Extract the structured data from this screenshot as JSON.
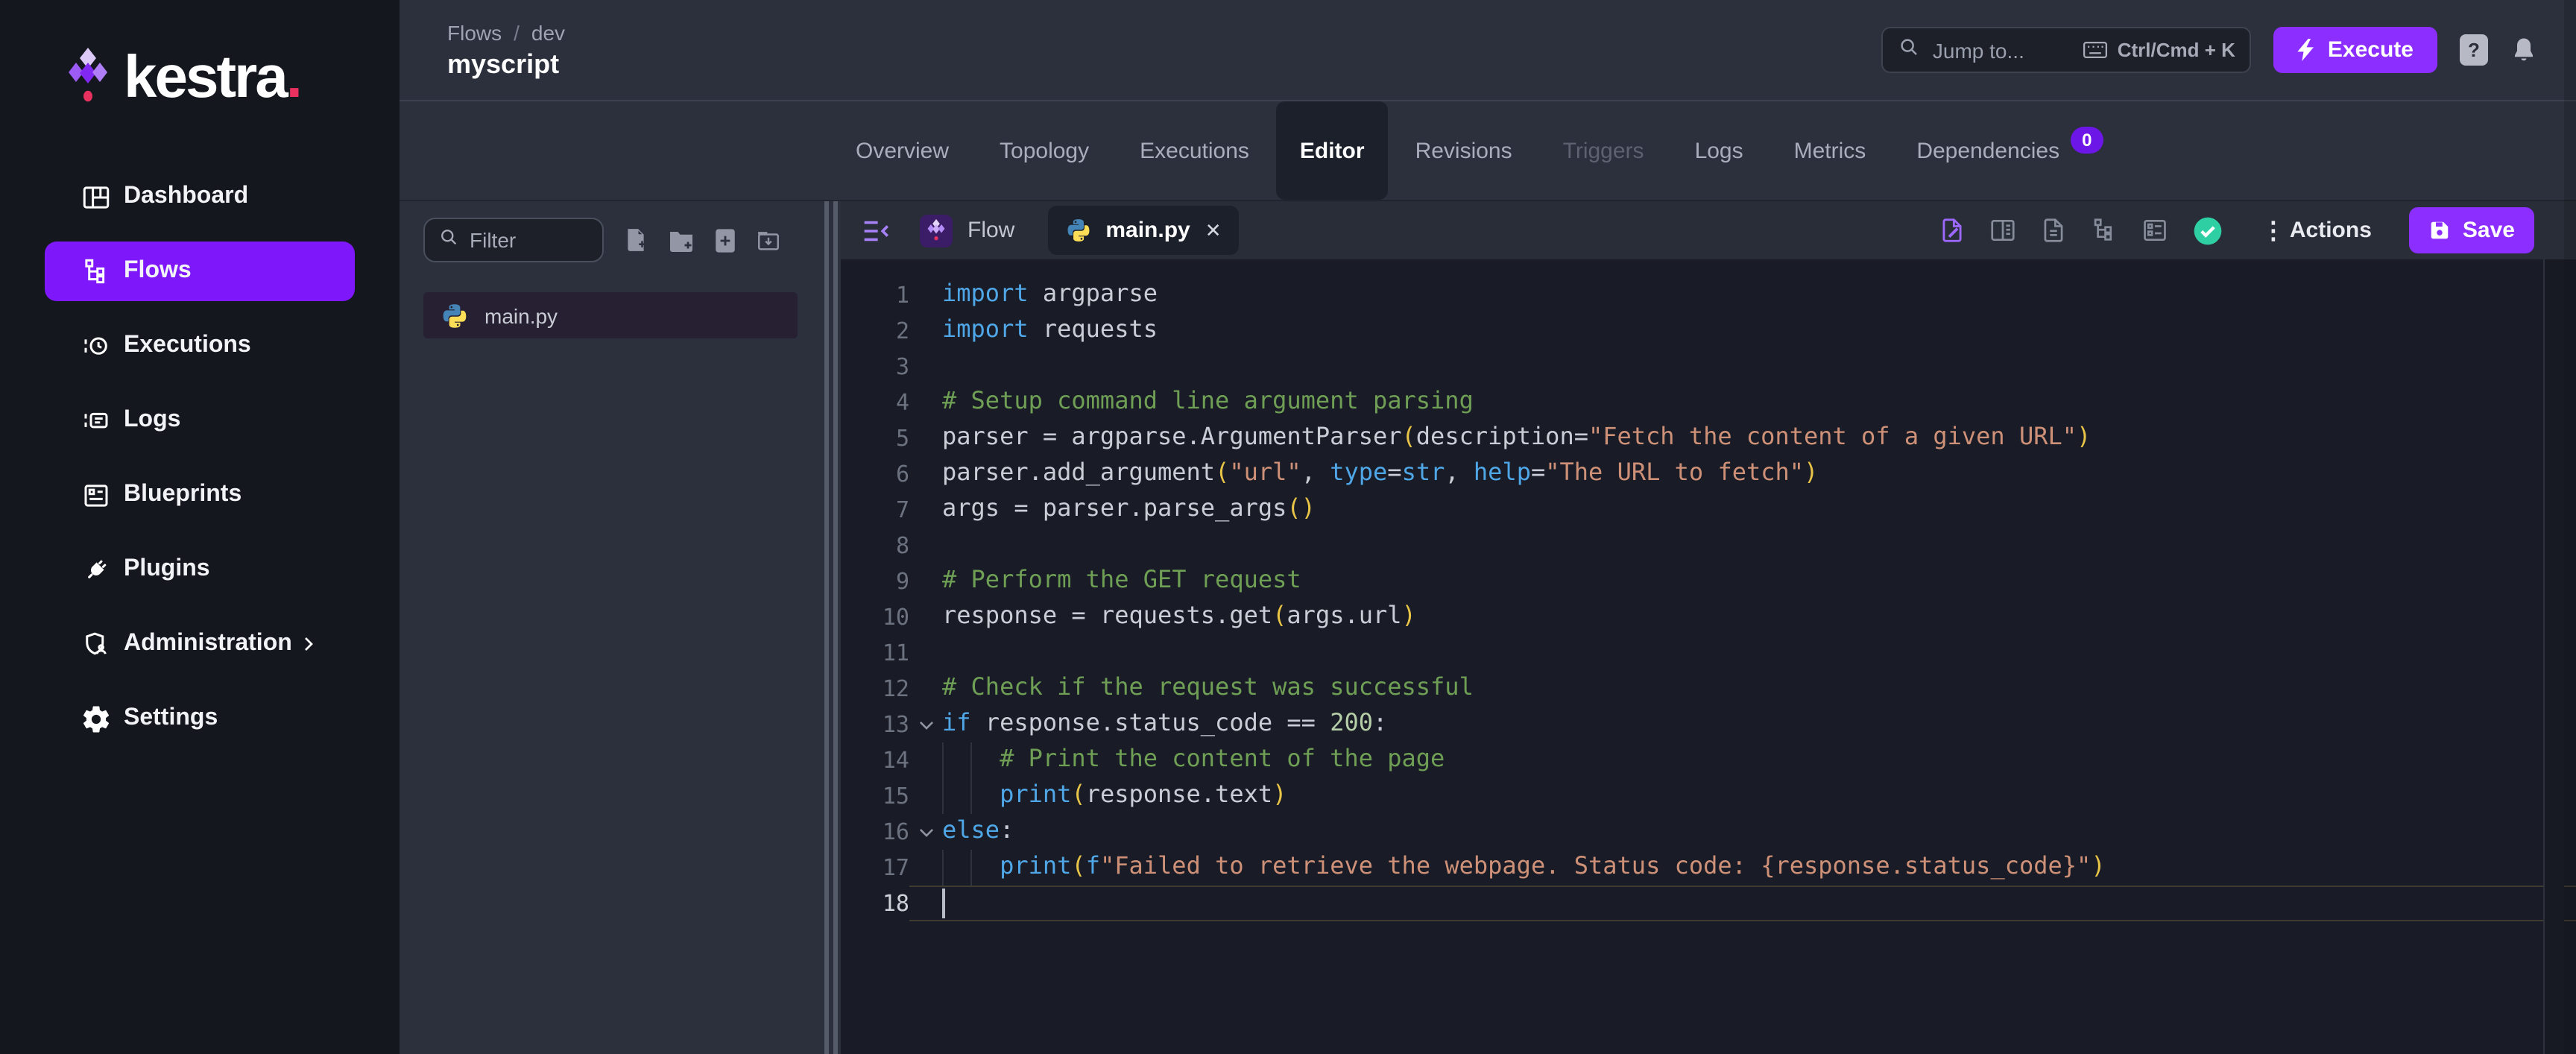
{
  "brand": {
    "name": "kestra",
    "dot": "."
  },
  "sidebar": {
    "items": [
      {
        "label": "Dashboard"
      },
      {
        "label": "Flows"
      },
      {
        "label": "Executions"
      },
      {
        "label": "Logs"
      },
      {
        "label": "Blueprints"
      },
      {
        "label": "Plugins"
      },
      {
        "label": "Administration"
      },
      {
        "label": "Settings"
      }
    ]
  },
  "header": {
    "breadcrumb": {
      "section": "Flows",
      "separator": "/",
      "namespace": "dev"
    },
    "title": "myscript",
    "search": {
      "placeholder": "Jump to...",
      "shortcut": "Ctrl/Cmd + K"
    },
    "execute_label": "Execute",
    "help_label": "?"
  },
  "nav_tabs": {
    "items": [
      {
        "label": "Overview"
      },
      {
        "label": "Topology"
      },
      {
        "label": "Executions"
      },
      {
        "label": "Editor"
      },
      {
        "label": "Revisions"
      },
      {
        "label": "Triggers"
      },
      {
        "label": "Logs"
      },
      {
        "label": "Metrics"
      },
      {
        "label": "Dependencies",
        "badge": "0"
      }
    ]
  },
  "explorer": {
    "filter_placeholder": "Filter",
    "files": [
      {
        "name": "main.py"
      }
    ]
  },
  "editor": {
    "flow_tab_label": "Flow",
    "file_tab": {
      "name": "main.py",
      "close": "✕"
    },
    "actions_label": "Actions",
    "save_label": "Save"
  },
  "colors": {
    "accent_purple": "#8B2EFF",
    "sidebar_active": "#7F17FB",
    "badge_purple": "#6D16E8",
    "validation_green": "#2FCFA4",
    "keyword_blue": "#4FA7E8",
    "comment_green": "#6F9E55",
    "string_salmon": "#CE9178",
    "paren_gold": "#E8C548",
    "number_green": "#B5CEA8"
  },
  "code": {
    "language": "python",
    "lines": [
      {
        "n": 1,
        "tokens": [
          [
            "k",
            "import"
          ],
          [
            "t",
            " argparse"
          ]
        ]
      },
      {
        "n": 2,
        "tokens": [
          [
            "k",
            "import"
          ],
          [
            "t",
            " requests"
          ]
        ]
      },
      {
        "n": 3,
        "tokens": []
      },
      {
        "n": 4,
        "tokens": [
          [
            "c",
            "# Setup command line argument parsing"
          ]
        ]
      },
      {
        "n": 5,
        "tokens": [
          [
            "t",
            "parser = argparse.ArgumentParser"
          ],
          [
            "p",
            "("
          ],
          [
            "t",
            "description="
          ],
          [
            "s",
            "\"Fetch the content of a given URL\""
          ],
          [
            "p",
            ")"
          ]
        ]
      },
      {
        "n": 6,
        "tokens": [
          [
            "t",
            "parser.add_argument"
          ],
          [
            "p",
            "("
          ],
          [
            "s",
            "\"url\""
          ],
          [
            "t",
            ", "
          ],
          [
            "k",
            "type"
          ],
          [
            "t",
            "="
          ],
          [
            "k",
            "str"
          ],
          [
            "t",
            ", "
          ],
          [
            "k",
            "help"
          ],
          [
            "t",
            "="
          ],
          [
            "s",
            "\"The URL to fetch\""
          ],
          [
            "p",
            ")"
          ]
        ]
      },
      {
        "n": 7,
        "tokens": [
          [
            "t",
            "args = parser.parse_args"
          ],
          [
            "p",
            "()"
          ]
        ]
      },
      {
        "n": 8,
        "tokens": []
      },
      {
        "n": 9,
        "tokens": [
          [
            "c",
            "# Perform the GET request"
          ]
        ]
      },
      {
        "n": 10,
        "tokens": [
          [
            "t",
            "response = requests.get"
          ],
          [
            "p",
            "("
          ],
          [
            "t",
            "args.url"
          ],
          [
            "p",
            ")"
          ]
        ]
      },
      {
        "n": 11,
        "tokens": []
      },
      {
        "n": 12,
        "tokens": [
          [
            "c",
            "# Check if the request was successful"
          ]
        ]
      },
      {
        "n": 13,
        "fold": true,
        "tokens": [
          [
            "k",
            "if"
          ],
          [
            "t",
            " response.status_code == "
          ],
          [
            "n2",
            "200"
          ],
          [
            "t",
            ":"
          ]
        ]
      },
      {
        "n": 14,
        "guides": true,
        "tokens": [
          [
            "t",
            "    "
          ],
          [
            "c",
            "# Print the content of the page"
          ]
        ]
      },
      {
        "n": 15,
        "guides": true,
        "tokens": [
          [
            "t",
            "    "
          ],
          [
            "k",
            "print"
          ],
          [
            "p",
            "("
          ],
          [
            "t",
            "response.text"
          ],
          [
            "p",
            ")"
          ]
        ]
      },
      {
        "n": 16,
        "fold": true,
        "tokens": [
          [
            "k",
            "else"
          ],
          [
            "t",
            ":"
          ]
        ]
      },
      {
        "n": 17,
        "guides": true,
        "tokens": [
          [
            "t",
            "    "
          ],
          [
            "k",
            "print"
          ],
          [
            "p",
            "("
          ],
          [
            "k",
            "f"
          ],
          [
            "s",
            "\"Failed to retrieve the webpage. Status code: {response.status_code}\""
          ],
          [
            "p",
            ")"
          ]
        ]
      },
      {
        "n": 18,
        "current": true,
        "tokens": []
      }
    ]
  }
}
